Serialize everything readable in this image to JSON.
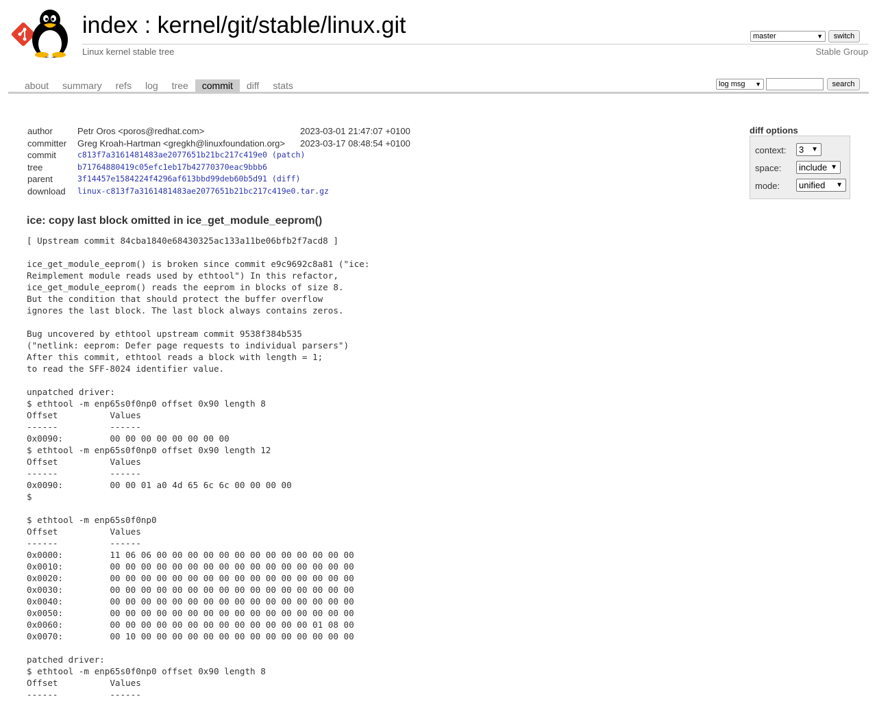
{
  "header": {
    "title_index": "index",
    "title_sep": " : ",
    "title_repo": "kernel/git/stable/linux.git",
    "subtitle": "Linux kernel stable tree",
    "owner": "Stable Group",
    "branch_selected": "master",
    "switch_label": "switch"
  },
  "tabs": [
    {
      "label": "about"
    },
    {
      "label": "summary"
    },
    {
      "label": "refs"
    },
    {
      "label": "log"
    },
    {
      "label": "tree"
    },
    {
      "label": "commit",
      "active": true
    },
    {
      "label": "diff"
    },
    {
      "label": "stats"
    }
  ],
  "search": {
    "mode_selected": "log msg",
    "query": "",
    "button_label": "search"
  },
  "commit_info": {
    "author": {
      "label": "author",
      "value": "Petr Oros <poros@redhat.com>",
      "date": "2023-03-01 21:47:07 +0100"
    },
    "committer": {
      "label": "committer",
      "value": "Greg Kroah-Hartman <gregkh@linuxfoundation.org>",
      "date": "2023-03-17 08:48:54 +0100"
    },
    "commit": {
      "label": "commit",
      "hash": "c813f7a3161481483ae2077651b21bc217c419e0",
      "extra_open": " (",
      "extra_link": "patch",
      "extra_close": ")"
    },
    "tree": {
      "label": "tree",
      "hash": "b71764880419c05efc1eb17b42770370eac9bbb6"
    },
    "parent": {
      "label": "parent",
      "hash": "3f14457e1584224f4296af613bbd99deb60b5d91",
      "extra_open": " (",
      "extra_link": "diff",
      "extra_close": ")"
    },
    "download": {
      "label": "download",
      "file": "linux-c813f7a3161481483ae2077651b21bc217c419e0.tar.gz"
    }
  },
  "diff_options": {
    "title": "diff options",
    "context": {
      "label": "context:",
      "value": "3"
    },
    "space": {
      "label": "space:",
      "value": "include"
    },
    "mode": {
      "label": "mode:",
      "value": "unified"
    }
  },
  "commit_subject": "ice: copy last block omitted in ice_get_module_eeprom()",
  "commit_message": "[ Upstream commit 84cba1840e68430325ac133a11be06bfb2f7acd8 ]\n\nice_get_module_eeprom() is broken since commit e9c9692c8a81 (\"ice:\nReimplement module reads used by ethtool\") In this refactor,\nice_get_module_eeprom() reads the eeprom in blocks of size 8.\nBut the condition that should protect the buffer overflow\nignores the last block. The last block always contains zeros.\n\nBug uncovered by ethtool upstream commit 9538f384b535\n(\"netlink: eeprom: Defer page requests to individual parsers\")\nAfter this commit, ethtool reads a block with length = 1;\nto read the SFF-8024 identifier value.\n\nunpatched driver:\n$ ethtool -m enp65s0f0np0 offset 0x90 length 8\nOffset          Values\n------          ------\n0x0090:         00 00 00 00 00 00 00 00\n$ ethtool -m enp65s0f0np0 offset 0x90 length 12\nOffset          Values\n------          ------\n0x0090:         00 00 01 a0 4d 65 6c 6c 00 00 00 00\n$\n\n$ ethtool -m enp65s0f0np0\nOffset          Values\n------          ------\n0x0000:         11 06 06 00 00 00 00 00 00 00 00 00 00 00 00 00\n0x0010:         00 00 00 00 00 00 00 00 00 00 00 00 00 00 00 00\n0x0020:         00 00 00 00 00 00 00 00 00 00 00 00 00 00 00 00\n0x0030:         00 00 00 00 00 00 00 00 00 00 00 00 00 00 00 00\n0x0040:         00 00 00 00 00 00 00 00 00 00 00 00 00 00 00 00\n0x0050:         00 00 00 00 00 00 00 00 00 00 00 00 00 00 00 00\n0x0060:         00 00 00 00 00 00 00 00 00 00 00 00 00 01 08 00\n0x0070:         00 10 00 00 00 00 00 00 00 00 00 00 00 00 00 00\n\npatched driver:\n$ ethtool -m enp65s0f0np0 offset 0x90 length 8\nOffset          Values\n------          ------"
}
